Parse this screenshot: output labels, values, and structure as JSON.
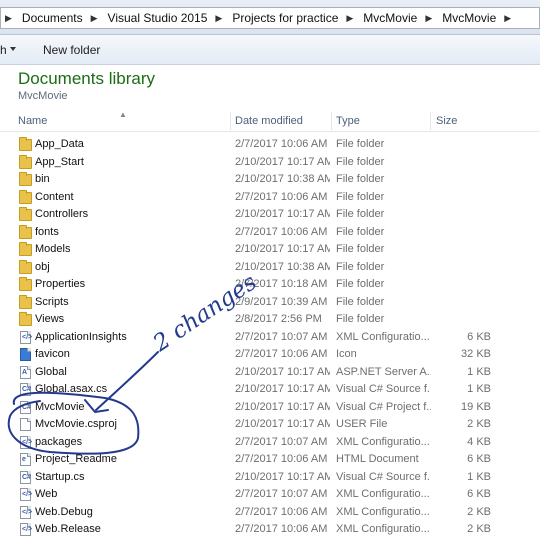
{
  "address_bar": {
    "crumbs": [
      "Documents",
      "Visual Studio 2015",
      "Projects for practice",
      "MvcMovie",
      "MvcMovie"
    ]
  },
  "toolbar": {
    "left_label": "h",
    "new_folder": "New folder"
  },
  "library": {
    "title": "Documents library",
    "subtitle": "MvcMovie"
  },
  "columns": {
    "name": "Name",
    "date": "Date modified",
    "type": "Type",
    "size": "Size"
  },
  "files": [
    {
      "name": "App_Data",
      "date": "2/7/2017 10:06 AM",
      "type": "File folder",
      "size": "",
      "icon": "folder-icon"
    },
    {
      "name": "App_Start",
      "date": "2/10/2017 10:17 AM",
      "type": "File folder",
      "size": "",
      "icon": "folder-icon"
    },
    {
      "name": "bin",
      "date": "2/10/2017 10:38 AM",
      "type": "File folder",
      "size": "",
      "icon": "folder-icon"
    },
    {
      "name": "Content",
      "date": "2/7/2017 10:06 AM",
      "type": "File folder",
      "size": "",
      "icon": "folder-icon"
    },
    {
      "name": "Controllers",
      "date": "2/10/2017 10:17 AM",
      "type": "File folder",
      "size": "",
      "icon": "folder-icon"
    },
    {
      "name": "fonts",
      "date": "2/7/2017 10:06 AM",
      "type": "File folder",
      "size": "",
      "icon": "folder-icon"
    },
    {
      "name": "Models",
      "date": "2/10/2017 10:17 AM",
      "type": "File folder",
      "size": "",
      "icon": "folder-icon"
    },
    {
      "name": "obj",
      "date": "2/10/2017 10:38 AM",
      "type": "File folder",
      "size": "",
      "icon": "folder-icon"
    },
    {
      "name": "Properties",
      "date": "2/7/2017 10:18 AM",
      "type": "File folder",
      "size": "",
      "icon": "folder-icon"
    },
    {
      "name": "Scripts",
      "date": "2/9/2017 10:39 AM",
      "type": "File folder",
      "size": "",
      "icon": "folder-icon"
    },
    {
      "name": "Views",
      "date": "2/8/2017 2:56 PM",
      "type": "File folder",
      "size": "",
      "icon": "folder-icon"
    },
    {
      "name": "ApplicationInsights",
      "date": "2/7/2017 10:07 AM",
      "type": "XML Configuratio...",
      "size": "6 KB",
      "icon": "xml-config-icon"
    },
    {
      "name": "favicon",
      "date": "2/7/2017 10:06 AM",
      "type": "Icon",
      "size": "32 KB",
      "icon": "favicon-icon"
    },
    {
      "name": "Global",
      "date": "2/10/2017 10:17 AM",
      "type": "ASP.NET Server A...",
      "size": "1 KB",
      "icon": "aspnet-icon"
    },
    {
      "name": "Global.asax.cs",
      "date": "2/10/2017 10:17 AM",
      "type": "Visual C# Source f...",
      "size": "1 KB",
      "icon": "csharp-file-icon"
    },
    {
      "name": "MvcMovie",
      "date": "2/10/2017 10:17 AM",
      "type": "Visual C# Project f...",
      "size": "19 KB",
      "icon": "csproj-icon"
    },
    {
      "name": "MvcMovie.csproj",
      "date": "2/10/2017 10:17 AM",
      "type": "USER File",
      "size": "2 KB",
      "icon": "user-file-icon"
    },
    {
      "name": "packages",
      "date": "2/7/2017 10:07 AM",
      "type": "XML Configuratio...",
      "size": "4 KB",
      "icon": "xml-config-icon"
    },
    {
      "name": "Project_Readme",
      "date": "2/7/2017 10:06 AM",
      "type": "HTML Document",
      "size": "6 KB",
      "icon": "html-file-icon"
    },
    {
      "name": "Startup.cs",
      "date": "2/10/2017 10:17 AM",
      "type": "Visual C# Source f...",
      "size": "1 KB",
      "icon": "csharp-file-icon"
    },
    {
      "name": "Web",
      "date": "2/7/2017 10:07 AM",
      "type": "XML Configuratio...",
      "size": "6 KB",
      "icon": "xml-config-icon"
    },
    {
      "name": "Web.Debug",
      "date": "2/7/2017 10:06 AM",
      "type": "XML Configuratio...",
      "size": "2 KB",
      "icon": "xml-config-icon"
    },
    {
      "name": "Web.Release",
      "date": "2/7/2017 10:06 AM",
      "type": "XML Configuratio...",
      "size": "2 KB",
      "icon": "xml-config-icon"
    }
  ],
  "annotation": {
    "text": "2 changes",
    "color": "#243a8f"
  }
}
